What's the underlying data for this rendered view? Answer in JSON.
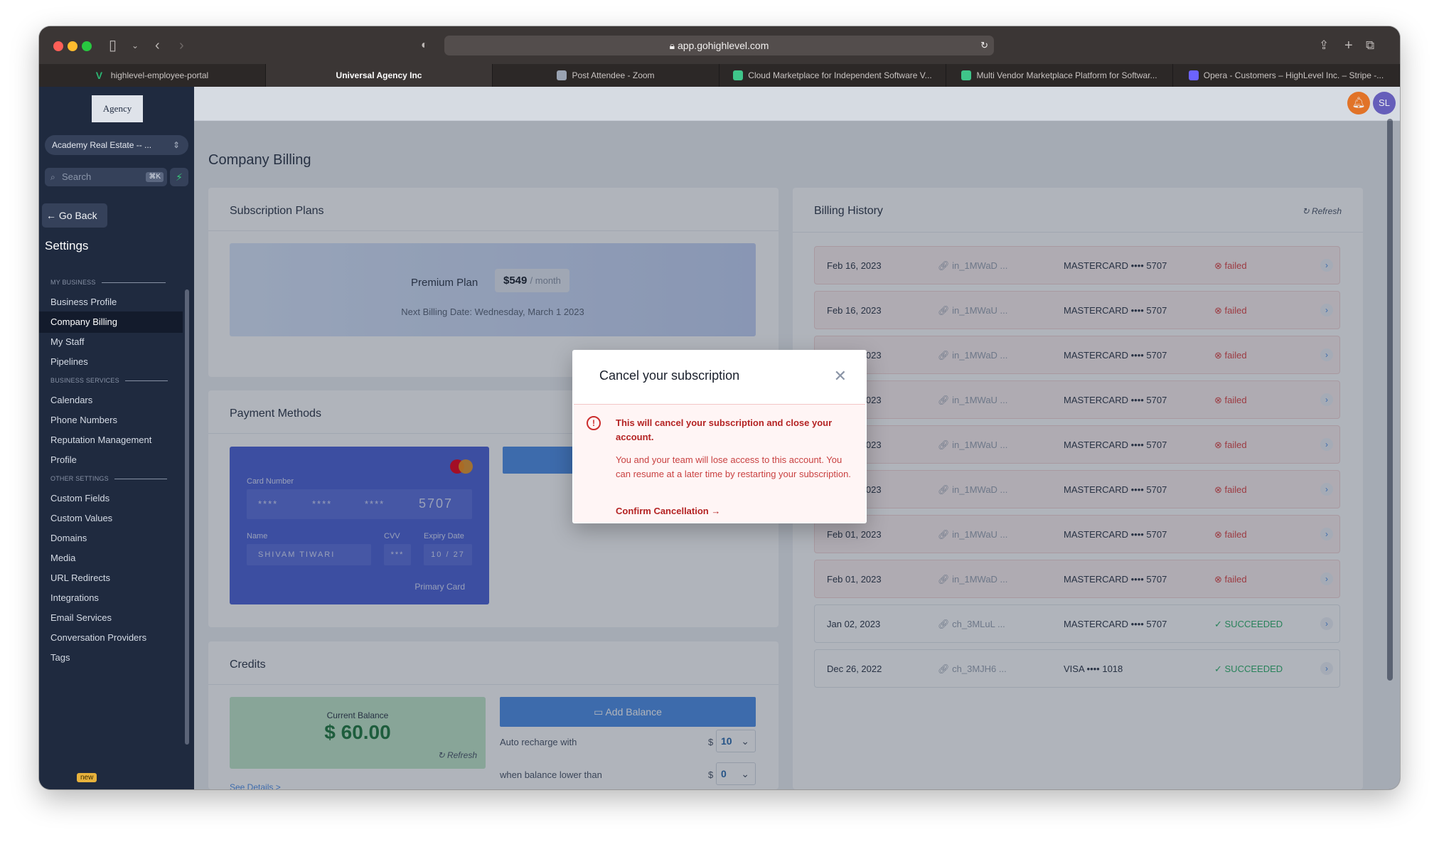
{
  "browser": {
    "url": "app.gohighlevel.com",
    "tabs": [
      {
        "label": "highlevel-employee-portal",
        "color": "#2bb673"
      },
      {
        "label": "Universal Agency Inc",
        "color": ""
      },
      {
        "label": "Post Attendee - Zoom",
        "color": "#9aa3b2"
      },
      {
        "label": "Cloud Marketplace for Independent Software V...",
        "color": "#3fc58a"
      },
      {
        "label": "Multi Vendor Marketplace Platform for Softwar...",
        "color": "#3fc58a"
      },
      {
        "label": "Opera - Customers – HighLevel Inc. – Stripe -...",
        "color": "#6c63ff"
      }
    ]
  },
  "sidebar": {
    "logo_text": "Agency",
    "account": "Academy Real Estate -- ...",
    "search_placeholder": "Search",
    "search_shortcut": "⌘K",
    "go_back": "Go Back",
    "title": "Settings",
    "sections": {
      "my_business": "MY BUSINESS",
      "business_services": "BUSINESS SERVICES",
      "other_settings": "OTHER SETTINGS"
    },
    "items": {
      "business_profile": "Business Profile",
      "company_billing": "Company Billing",
      "my_staff": "My Staff",
      "pipelines": "Pipelines",
      "calendars": "Calendars",
      "phone_numbers": "Phone Numbers",
      "reputation": "Reputation Management",
      "profile": "Profile",
      "custom_fields": "Custom Fields",
      "custom_values": "Custom Values",
      "domains": "Domains",
      "media": "Media",
      "url_redirects": "URL Redirects",
      "integrations": "Integrations",
      "email_services": "Email Services",
      "conversation_providers": "Conversation Providers",
      "tags": "Tags"
    },
    "new_badge": "new"
  },
  "header": {
    "avatar": "SL"
  },
  "page": {
    "title": "Company Billing",
    "subscription": {
      "heading": "Subscription Plans",
      "plan_name": "Premium Plan",
      "price": "$549",
      "period": "/ month",
      "next_billing": "Next Billing Date: Wednesday, March 1 2023"
    },
    "payment": {
      "heading": "Payment Methods",
      "card_number_label": "Card Number",
      "card_groups": [
        "****",
        "****",
        "****",
        "5707"
      ],
      "name_label": "Name",
      "name": "SHIVAM TIWARI",
      "cvv_label": "CVV",
      "cvv": "***",
      "expiry_label": "Expiry Date",
      "expiry": "10 / 27",
      "primary": "Primary Card"
    },
    "credits": {
      "heading": "Credits",
      "balance_label": "Current Balance",
      "balance": "$ 60.00",
      "refresh": "Refresh",
      "add_balance": "Add Balance",
      "auto_recharge": "Auto recharge with",
      "auto_value": "10",
      "lower_than": "when balance lower than",
      "lower_value": "0",
      "currency": "$",
      "see_details": "See Details >"
    },
    "history": {
      "heading": "Billing History",
      "refresh": "Refresh",
      "rows": [
        {
          "date": "Feb 16, 2023",
          "id": "in_1MWaD ...",
          "card": "MASTERCARD •••• 5707",
          "status": "failed"
        },
        {
          "date": "Feb 16, 2023",
          "id": "in_1MWaU ...",
          "card": "MASTERCARD •••• 5707",
          "status": "failed"
        },
        {
          "date": "Feb 16, 2023",
          "id": "in_1MWaD ...",
          "card": "MASTERCARD •••• 5707",
          "status": "failed"
        },
        {
          "date": "Feb 16, 2023",
          "id": "in_1MWaU ...",
          "card": "MASTERCARD •••• 5707",
          "status": "failed"
        },
        {
          "date": "Feb 16, 2023",
          "id": "in_1MWaU ...",
          "card": "MASTERCARD •••• 5707",
          "status": "failed"
        },
        {
          "date": "Feb 01, 2023",
          "id": "in_1MWaD ...",
          "card": "MASTERCARD •••• 5707",
          "status": "failed"
        },
        {
          "date": "Feb 01, 2023",
          "id": "in_1MWaU ...",
          "card": "MASTERCARD •••• 5707",
          "status": "failed"
        },
        {
          "date": "Feb 01, 2023",
          "id": "in_1MWaD ...",
          "card": "MASTERCARD •••• 5707",
          "status": "failed"
        },
        {
          "date": "Jan 02, 2023",
          "id": "ch_3MLuL ...",
          "card": "MASTERCARD •••• 5707",
          "status": "SUCCEEDED"
        },
        {
          "date": "Dec 26, 2022",
          "id": "ch_3MJH6 ...",
          "card": "VISA •••• 1018",
          "status": "SUCCEEDED"
        }
      ]
    }
  },
  "modal": {
    "title": "Cancel your subscription",
    "warning": "This will cancel your subscription and close your account.",
    "detail": "You and your team will lose access to this account. You can resume at a later time by restarting your subscription.",
    "confirm": "Confirm Cancellation"
  },
  "colors": {
    "accent": "#4f8fe8",
    "danger": "#e04646",
    "success": "#2fb36a",
    "sidebar": "#1f2a3f"
  }
}
